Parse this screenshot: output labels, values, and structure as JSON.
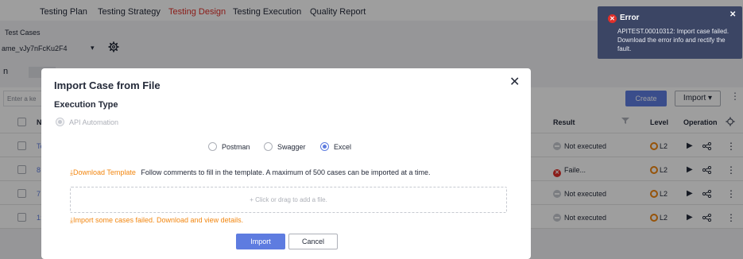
{
  "topnav": {
    "items": [
      "Testing Plan",
      "Testing Strategy",
      "Testing Design",
      "Testing Execution",
      "Quality Report"
    ],
    "active_index": 2
  },
  "breadcrumb": "Test Cases",
  "version_select": {
    "value": "ame_vJy7nFcKu2F4"
  },
  "tab_label": "n",
  "search": {
    "placeholder": "Enter a ke"
  },
  "toolbar": {
    "create_label": "Create",
    "import_label": "Import"
  },
  "table": {
    "headers": {
      "name": "N",
      "result": "Result",
      "level": "Level",
      "operation": "Operation"
    },
    "rows": [
      {
        "id": "Te",
        "result": "Not executed",
        "result_status": "not-executed",
        "level": "L2"
      },
      {
        "id": "8",
        "result": "Faile...",
        "result_status": "failed",
        "level": "L2"
      },
      {
        "id": "7",
        "result": "Not executed",
        "result_status": "not-executed",
        "level": "L2"
      },
      {
        "id": "1:",
        "result": "Not executed",
        "result_status": "not-executed",
        "level": "L2"
      }
    ]
  },
  "modal": {
    "title": "Import Case from File",
    "section_label": "Execution Type",
    "execution_type": "API Automation",
    "formats": [
      {
        "label": "Postman",
        "checked": false
      },
      {
        "label": "Swagger",
        "checked": false
      },
      {
        "label": "Excel",
        "checked": true
      }
    ],
    "download_link": "Download Template",
    "download_hint": "Follow comments to fill in the template. A maximum of 500 cases can be imported at a time.",
    "dropzone_text": "+ Click or drag to add a file.",
    "failed_link": "Import some cases failed. Download and view details.",
    "import_label": "Import",
    "cancel_label": "Cancel"
  },
  "toast": {
    "title": "Error",
    "message": "APITEST.00010312: Import case failed. Download the error info and rectify the fault."
  },
  "colors": {
    "brand": "#5e7ce0",
    "active_nav": "#e0302a",
    "warning": "#f2860f",
    "error": "#e0302a",
    "toast_bg": "#3b4564"
  },
  "icons": {
    "settings": "gear-icon",
    "close": "close-icon",
    "download": "download-icon",
    "filter": "filter-icon",
    "run": "play-icon",
    "share": "share-icon",
    "more": "more-vertical-icon",
    "error": "error-icon"
  }
}
